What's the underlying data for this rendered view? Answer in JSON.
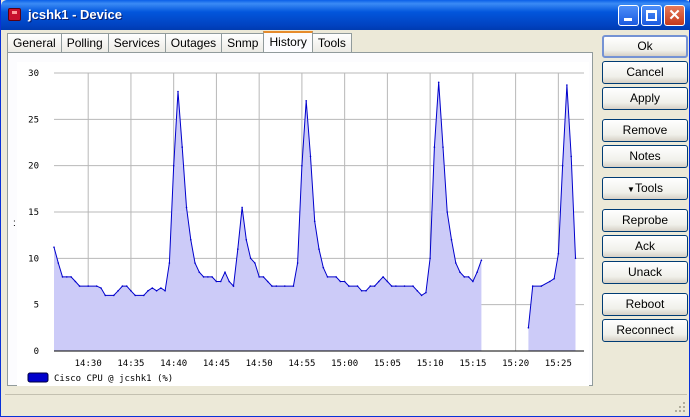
{
  "window": {
    "title": "jcshk1 - Device",
    "app_icon": "router-icon",
    "controls": [
      "minimize-icon",
      "maximize-icon",
      "close-icon"
    ],
    "colors": {
      "titlebar": "#0142c0",
      "face": "#ece9d8"
    }
  },
  "tabs": [
    {
      "label": "General",
      "active": false
    },
    {
      "label": "Polling",
      "active": false
    },
    {
      "label": "Services",
      "active": false
    },
    {
      "label": "Outages",
      "active": false
    },
    {
      "label": "Snmp",
      "active": false
    },
    {
      "label": "History",
      "active": true
    },
    {
      "label": "Tools",
      "active": false
    }
  ],
  "buttons": {
    "ok": "Ok",
    "cancel": "Cancel",
    "apply": "Apply",
    "remove": "Remove",
    "notes": "Notes",
    "tools": "Tools",
    "reprobe": "Reprobe",
    "ack": "Ack",
    "unack": "Unack",
    "reboot": "Reboot",
    "reconnect": "Reconnect"
  },
  "side_marker": ":",
  "chart_data": {
    "type": "area",
    "ylim": [
      0,
      30
    ],
    "yticks": [
      "0",
      "5",
      "10",
      "15",
      "20",
      "25",
      "30"
    ],
    "xlim": [
      "14:26",
      "15:28"
    ],
    "xticks": [
      "14:30",
      "14:35",
      "14:40",
      "14:45",
      "14:50",
      "14:55",
      "15:00",
      "15:05",
      "15:10",
      "15:15",
      "15:20",
      "15:25"
    ],
    "grid": true,
    "legend": "bottom-left",
    "series": [
      {
        "name": "Cisco CPU @ jcshk1 (%)",
        "color": "#0000cc",
        "fill": "#cccbf8",
        "segments": [
          [
            [
              "14:26:00",
              11.2
            ],
            [
              "14:26:30",
              9.5
            ],
            [
              "14:27:00",
              8.0
            ],
            [
              "14:27:30",
              8.0
            ],
            [
              "14:28:00",
              8.0
            ],
            [
              "14:28:30",
              7.5
            ],
            [
              "14:29:00",
              7.0
            ],
            [
              "14:30:00",
              7.0
            ],
            [
              "14:31:00",
              7.0
            ],
            [
              "14:31:30",
              6.8
            ],
            [
              "14:32:00",
              6.0
            ],
            [
              "14:33:00",
              6.0
            ],
            [
              "14:33:30",
              6.5
            ],
            [
              "14:34:00",
              7.0
            ],
            [
              "14:34:30",
              7.0
            ],
            [
              "14:35:00",
              6.5
            ],
            [
              "14:35:30",
              6.0
            ],
            [
              "14:36:30",
              6.0
            ],
            [
              "14:37:00",
              6.5
            ],
            [
              "14:37:30",
              6.8
            ],
            [
              "14:38:00",
              6.5
            ],
            [
              "14:38:30",
              6.8
            ],
            [
              "14:39:00",
              6.5
            ],
            [
              "14:39:30",
              9.5
            ],
            [
              "14:40:00",
              20.0
            ],
            [
              "14:40:30",
              28.0
            ],
            [
              "14:41:00",
              22.0
            ],
            [
              "14:41:30",
              15.5
            ],
            [
              "14:42:00",
              12.0
            ],
            [
              "14:42:30",
              9.5
            ],
            [
              "14:43:00",
              8.5
            ],
            [
              "14:43:30",
              8.0
            ],
            [
              "14:44:00",
              8.0
            ],
            [
              "14:44:30",
              8.0
            ],
            [
              "14:45:00",
              7.5
            ],
            [
              "14:45:30",
              7.5
            ],
            [
              "14:46:00",
              8.5
            ],
            [
              "14:46:30",
              7.5
            ],
            [
              "14:47:00",
              7.0
            ],
            [
              "14:47:30",
              11.0
            ],
            [
              "14:48:00",
              15.5
            ],
            [
              "14:48:30",
              12.0
            ],
            [
              "14:49:00",
              10.0
            ],
            [
              "14:49:30",
              9.5
            ],
            [
              "14:50:00",
              8.0
            ],
            [
              "14:50:30",
              8.0
            ],
            [
              "14:51:00",
              7.5
            ],
            [
              "14:51:30",
              7.0
            ],
            [
              "14:52:00",
              7.0
            ],
            [
              "14:53:00",
              7.0
            ],
            [
              "14:54:00",
              7.0
            ],
            [
              "14:54:30",
              9.5
            ],
            [
              "14:55:00",
              20.0
            ],
            [
              "14:55:30",
              27.0
            ],
            [
              "14:56:00",
              21.0
            ],
            [
              "14:56:30",
              14.0
            ],
            [
              "14:57:00",
              11.0
            ],
            [
              "14:57:30",
              9.0
            ],
            [
              "14:58:00",
              8.0
            ],
            [
              "14:59:00",
              8.0
            ],
            [
              "14:59:30",
              7.5
            ],
            [
              "15:00:00",
              7.5
            ],
            [
              "15:00:30",
              7.0
            ],
            [
              "15:01:30",
              7.0
            ],
            [
              "15:02:00",
              6.5
            ],
            [
              "15:02:30",
              6.5
            ],
            [
              "15:03:00",
              7.0
            ],
            [
              "15:03:30",
              7.0
            ],
            [
              "15:04:00",
              7.5
            ],
            [
              "15:04:30",
              8.0
            ],
            [
              "15:05:00",
              7.5
            ],
            [
              "15:05:30",
              7.0
            ],
            [
              "15:06:00",
              7.0
            ],
            [
              "15:07:00",
              7.0
            ],
            [
              "15:08:00",
              7.0
            ],
            [
              "15:08:30",
              6.5
            ],
            [
              "15:09:00",
              6.0
            ],
            [
              "15:09:30",
              6.3
            ],
            [
              "15:10:00",
              10.0
            ],
            [
              "15:10:30",
              22.0
            ],
            [
              "15:11:00",
              29.0
            ],
            [
              "15:11:30",
              22.0
            ],
            [
              "15:12:00",
              15.0
            ],
            [
              "15:12:30",
              12.0
            ],
            [
              "15:13:00",
              9.5
            ],
            [
              "15:13:30",
              8.5
            ],
            [
              "15:14:00",
              8.0
            ],
            [
              "15:14:30",
              8.0
            ],
            [
              "15:15:00",
              7.5
            ],
            [
              "15:15:30",
              8.5
            ],
            [
              "15:16:00",
              9.8
            ]
          ],
          [
            [
              "15:21:30",
              2.5
            ],
            [
              "15:22:00",
              7.0
            ],
            [
              "15:23:00",
              7.0
            ],
            [
              "15:24:00",
              7.5
            ],
            [
              "15:24:30",
              7.8
            ],
            [
              "15:25:00",
              10.5
            ],
            [
              "15:25:30",
              20.0
            ],
            [
              "15:26:00",
              28.7
            ],
            [
              "15:26:30",
              21.0
            ],
            [
              "15:27:00",
              10.0
            ]
          ]
        ]
      }
    ]
  }
}
